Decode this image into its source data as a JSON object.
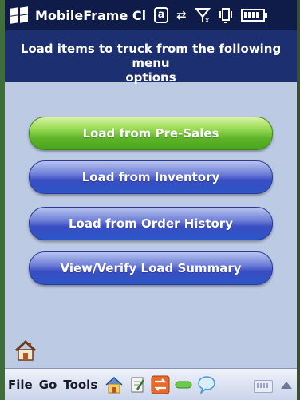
{
  "status_bar": {
    "app_title": "MobileFrame Cl",
    "icons": [
      "windows-logo-icon",
      "a-key-icon",
      "sync-arrows-icon",
      "signal-off-icon",
      "vibrate-icon",
      "battery-icon"
    ]
  },
  "header": {
    "line1": "Load items to truck from the  following menu",
    "line2": "options"
  },
  "buttons": [
    {
      "label": "Load from Pre-Sales",
      "color": "#5fb52a"
    },
    {
      "label": "Load from Inventory",
      "color": "#3a4dc2"
    },
    {
      "label": "Load from Order History",
      "color": "#3a4dc2"
    },
    {
      "label": "View/Verify Load Summary",
      "color": "#3a4dc2"
    }
  ],
  "menubar": {
    "file": "File",
    "go": "Go",
    "tools": "Tools",
    "icons": [
      "home-icon",
      "notepad-icon",
      "swap-icon",
      "battery-pill-icon",
      "speech-bubble-icon",
      "keyboard-icon",
      "up-arrow-icon"
    ]
  },
  "colors": {
    "status_bg": "#0f1c4a",
    "header_bg": "#1c2f70",
    "screen_bg": "#bccae4"
  }
}
